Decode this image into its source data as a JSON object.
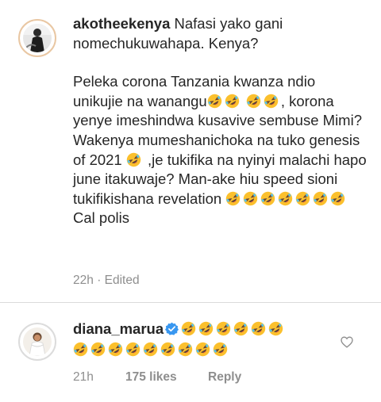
{
  "comment1": {
    "username": "akotheekenya",
    "text_head": "Nafasi yako gani nomechukuwahapa. Kenya?",
    "text_p1": "Peleka corona Tanzania kwanza ndio unikujie na wanangu",
    "text_p2": ", korona yenye imeshindwa kusavive sembuse Mimi? Wakenya mumeshanichoka na tuko genesis of 2021",
    "text_p3": " ,je tukifika na nyinyi malachi hapo june itakuwaje? Man-ake hiu speed sioni tukifikishana revelation",
    "text_p4": "Cal polis",
    "time": "22h",
    "edited": "Edited"
  },
  "comment2": {
    "username": "diana_marua",
    "time": "21h",
    "likes": "175 likes",
    "reply": "Reply"
  },
  "icons": {
    "emoji": "rolling-on-the-floor-laughing",
    "verified": "verified-badge",
    "like": "heart-outline"
  },
  "colors": {
    "text": "#262626",
    "muted": "#8e8e8e",
    "verified": "#3897f0",
    "emoji": "#fbc02d"
  }
}
